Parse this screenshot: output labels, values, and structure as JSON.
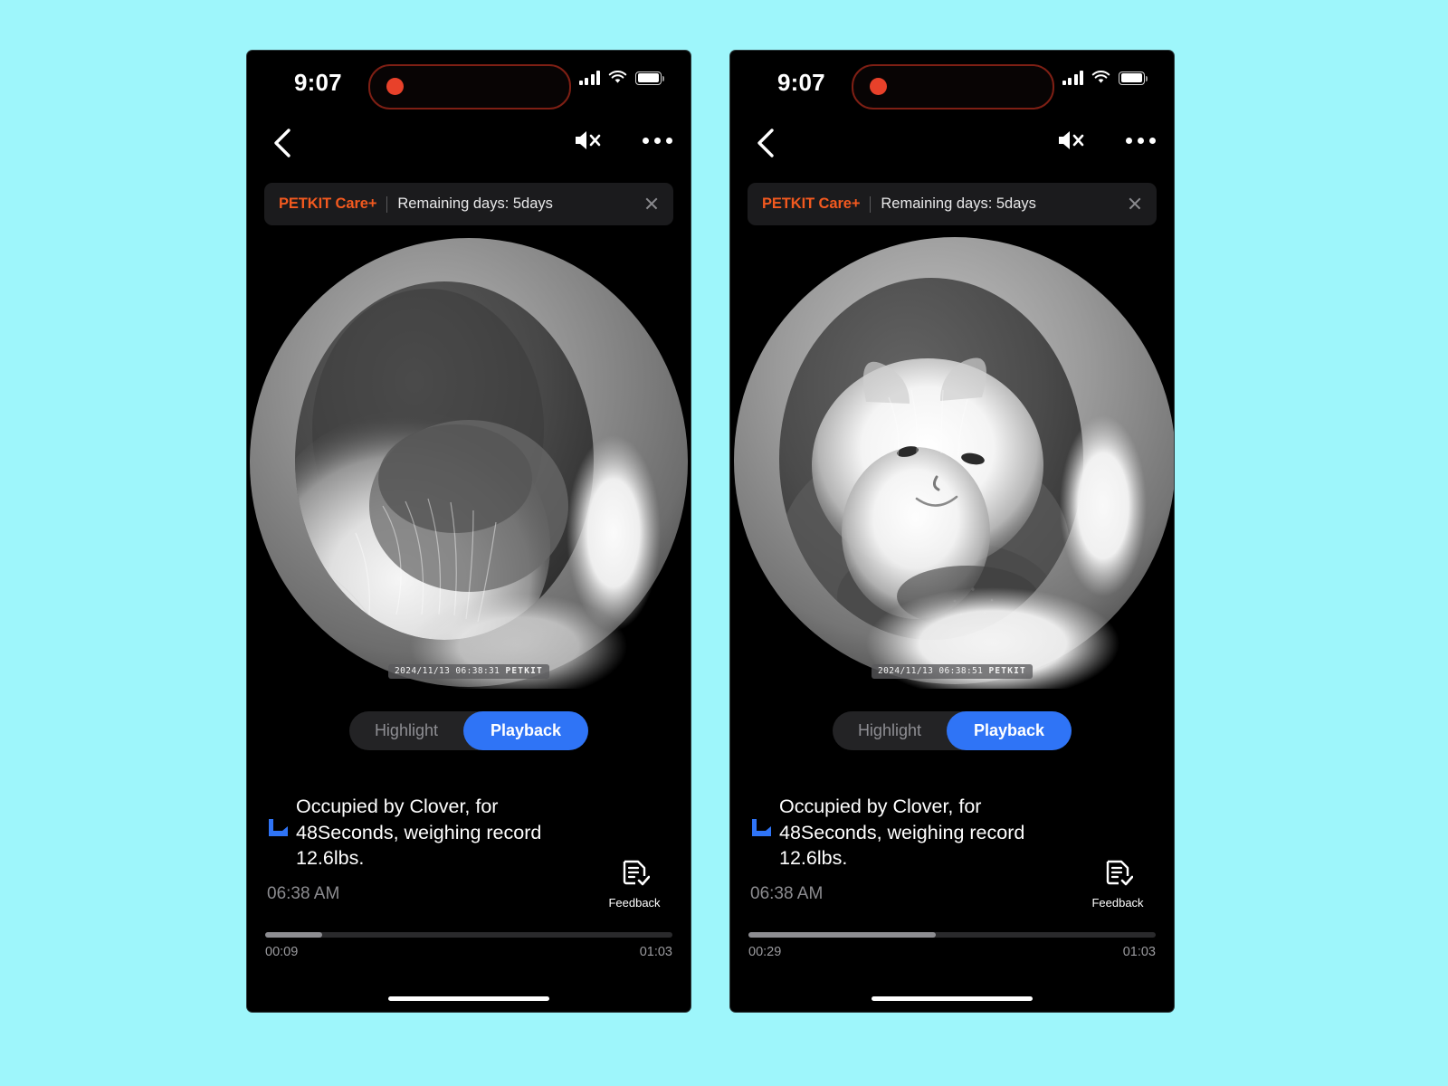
{
  "background_color": "#9ef6fb",
  "accent_color": "#2f74f6",
  "brand_color": "#f2591f",
  "phones": [
    {
      "status": {
        "clock": "9:07",
        "recording_indicator": "record-dot",
        "signal_icon": "cellular-signal-icon",
        "wifi_icon": "wifi-icon",
        "battery_icon": "battery-full-icon"
      },
      "nav": {
        "back_icon": "back-chevron-icon",
        "mute_icon": "speaker-muted-icon",
        "more_icon": "more-options-icon"
      },
      "banner": {
        "brand": "PETKIT Care+",
        "text": "Remaining days: 5days",
        "close_icon": "close-icon"
      },
      "video": {
        "timestamp": "2024/11/13 06:38:31",
        "brand": "PETKIT",
        "scene": "infrared-fisheye-litterbox-cat"
      },
      "tabs": [
        {
          "label": "Highlight",
          "active": false
        },
        {
          "label": "Playback",
          "active": true
        }
      ],
      "event": {
        "icon": "litter-box-icon",
        "description": "Occupied by Clover, for 48Seconds, weighing record 12.6lbs.",
        "time": "06:38 AM",
        "feedback_label": "Feedback",
        "feedback_icon": "document-edit-icon"
      },
      "progress": {
        "current": "00:09",
        "total": "01:03",
        "percent": 14
      }
    },
    {
      "status": {
        "clock": "9:07",
        "recording_indicator": "record-dot",
        "signal_icon": "cellular-signal-icon",
        "wifi_icon": "wifi-icon",
        "battery_icon": "battery-full-icon"
      },
      "nav": {
        "back_icon": "back-chevron-icon",
        "mute_icon": "speaker-muted-icon",
        "more_icon": "more-options-icon"
      },
      "banner": {
        "brand": "PETKIT Care+",
        "text": "Remaining days: 5days",
        "close_icon": "close-icon"
      },
      "video": {
        "timestamp": "2024/11/13 06:38:51",
        "brand": "PETKIT",
        "scene": "infrared-fisheye-litterbox-cat-face"
      },
      "tabs": [
        {
          "label": "Highlight",
          "active": false
        },
        {
          "label": "Playback",
          "active": true
        }
      ],
      "event": {
        "icon": "litter-box-icon",
        "description": "Occupied by Clover, for 48Seconds, weighing record 12.6lbs.",
        "time": "06:38 AM",
        "feedback_label": "Feedback",
        "feedback_icon": "document-edit-icon"
      },
      "progress": {
        "current": "00:29",
        "total": "01:03",
        "percent": 46
      }
    }
  ]
}
